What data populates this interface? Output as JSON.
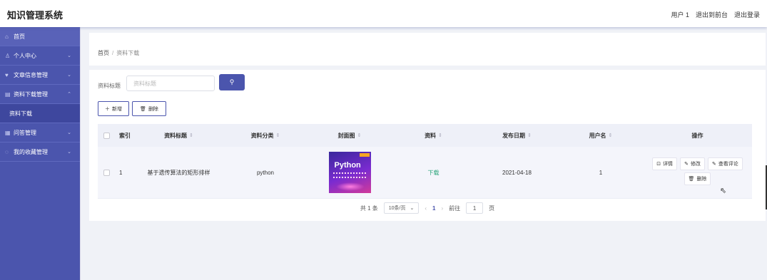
{
  "app": {
    "title": "知识管理系统"
  },
  "topnav": {
    "user": "用户 1",
    "to_front": "退出到前台",
    "logout": "退出登录"
  },
  "sidebar": {
    "items": [
      {
        "label": "首页",
        "icon": "home-icon"
      },
      {
        "label": "个人中心",
        "icon": "user-icon"
      },
      {
        "label": "文章信息管理",
        "icon": "shield-icon"
      },
      {
        "label": "资料下载管理",
        "icon": "folder-icon"
      },
      {
        "label": "资料下载",
        "sub": true
      },
      {
        "label": "问答管理",
        "icon": "grid-icon"
      },
      {
        "label": "我的收藏管理",
        "icon": "info-icon"
      }
    ]
  },
  "breadcrumb": {
    "home": "首页",
    "separator": "/",
    "current": "资料下载"
  },
  "search": {
    "label": "资料标题",
    "placeholder": "资料标题",
    "button_icon": "search-icon"
  },
  "toolbar": {
    "add_label": "新增",
    "delete_label": "删除"
  },
  "table": {
    "headers": {
      "index": "索引",
      "title": "资料标题",
      "category": "资料分类",
      "cover": "封面图",
      "file": "资料",
      "date": "发布日期",
      "user": "用户名",
      "ops": "操作"
    },
    "rows": [
      {
        "index": "1",
        "title": "基于遗传算法的矩形排样",
        "category": "python",
        "cover_text": "Python",
        "file": "下载",
        "date": "2021-04-18",
        "user": "1",
        "ops": {
          "detail": "详情",
          "edit": "修改",
          "comments": "查看评论",
          "delete": "删除"
        }
      }
    ]
  },
  "pagination": {
    "total": "共 1 条",
    "page_size": "10条/页",
    "current_page": "1",
    "goto_label": "前往",
    "goto_value": "1",
    "page_suffix": "页"
  },
  "colors": {
    "primary": "#4b55ad",
    "link": "#2aa57a",
    "background": "#f0f2f7"
  }
}
